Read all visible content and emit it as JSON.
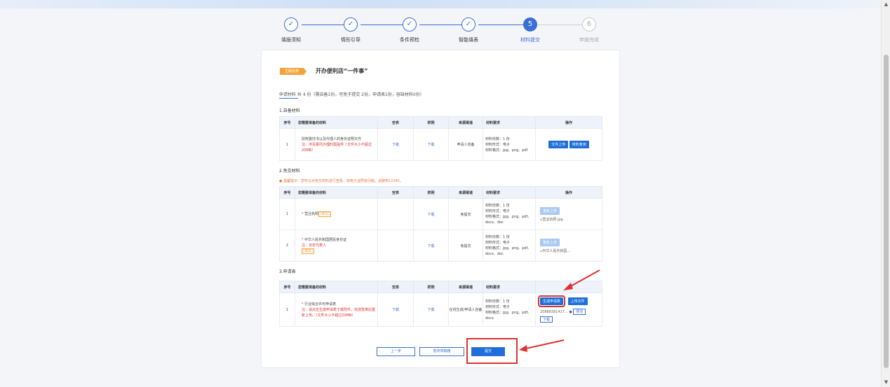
{
  "steps": [
    {
      "label": "填报须知",
      "state": "done",
      "mark": "✓"
    },
    {
      "label": "情形引导",
      "state": "done",
      "mark": "✓"
    },
    {
      "label": "条件预检",
      "state": "done",
      "mark": "✓"
    },
    {
      "label": "智能填表",
      "state": "done",
      "mark": "✓"
    },
    {
      "label": "材料提交",
      "state": "active",
      "mark": "5"
    },
    {
      "label": "申报完成",
      "state": "todo",
      "mark": "6"
    }
  ],
  "matter": {
    "badge": "主题名称",
    "title": "开办便利店“一件事”"
  },
  "summary": "申请材料 共 4 份（需自备1份，可免于提交 2份，申请表1份，容缺材料0份）",
  "columns": {
    "no": "序号",
    "name": "您需要准备的材料",
    "blank": "空表",
    "sample": "样例",
    "source": "来源渠道",
    "req": "材料要求",
    "op": "操作"
  },
  "sections": {
    "self": {
      "title": "1.自备材料",
      "rows": [
        {
          "no": "1",
          "name": "授权委托书以及代理人的身份证明文件",
          "note": "注：涉及委托办理时需提供（文件大小不超过20MB）",
          "blank": "下载",
          "sample": "下载",
          "source": "申请人自备",
          "req": [
            "材料份数：1 份",
            "材料形式：电子",
            "材料格式：jpg、png、pdf"
          ],
          "btn1": "文件上传",
          "btn2": "材料复用"
        }
      ]
    },
    "exempt": {
      "title": "2.免交材料",
      "tip": "温馨提示：您可以对免交材料进行查看，如电子证照有问题，请致电12345。",
      "rows": [
        {
          "no": "1",
          "name": "营业执照",
          "fill": "[填充]",
          "note": "",
          "sample": "下载",
          "source": "免提交",
          "req": [
            "材料份数：1 份",
            "材料形式：电子",
            "材料格式：jpg、png、pdf、docx、doc"
          ],
          "btn": "重新上传",
          "file": "营业执照.jpg"
        },
        {
          "no": "2",
          "name": "中华人民共和国居民身份证",
          "fill": "[填充]",
          "note": "注：法定代表人",
          "sample": "下载",
          "source": "免提交",
          "req": [
            "材料份数：1 份",
            "材料形式：电子",
            "材料格式：jpg、png、pdf、docx、doc"
          ],
          "btn": "重新上传",
          "file": "中华人民共和国..."
        }
      ]
    },
    "form": {
      "title": "3.申请表",
      "rows": [
        {
          "no": "1",
          "name": "行业综合许可申请表",
          "note": "注：请点击生成申请表下载附件，完成签章后重新上传。（文件大小不超过20MB）",
          "blank": "下载",
          "sample": "下载",
          "source": "在线生成/申请人自备",
          "req": [
            "材料份数：1 份",
            "材料形式：电子",
            "材料格式：jpg、png、pdf、docx"
          ],
          "gen": "生成申请表",
          "upload": "上传文件",
          "file": "20888381417...",
          "preview": "预览",
          "download": "下载"
        }
      ]
    }
  },
  "footer": {
    "prev": "上一步",
    "save": "暂存草稿箱",
    "submit": "提交"
  },
  "colors": {
    "primary": "#1e6fd9",
    "accent": "#f3a43b",
    "alert": "#e0312f"
  }
}
